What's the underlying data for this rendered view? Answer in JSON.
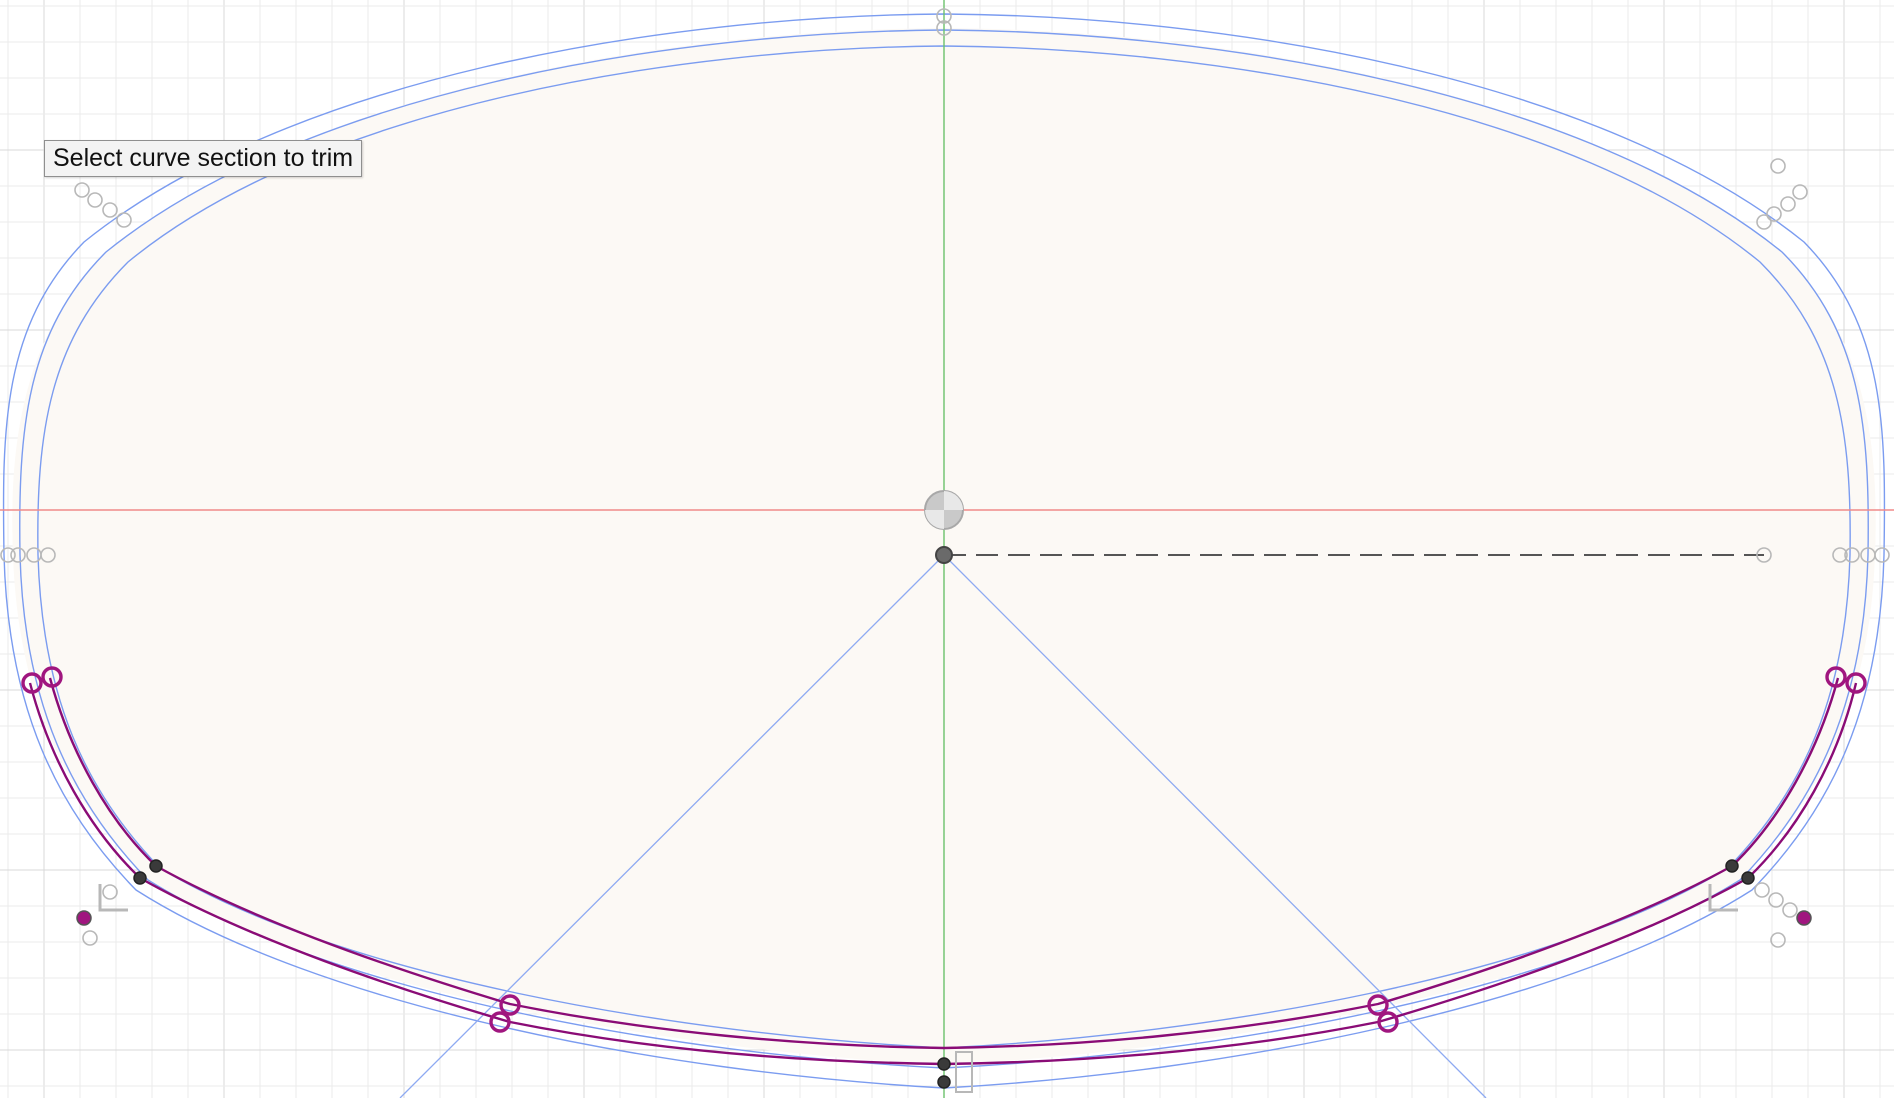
{
  "tooltip": {
    "text": "Select curve section to trim"
  },
  "colors": {
    "background": "#ffffff",
    "grid_minor": "#ebebeb",
    "grid_major": "#d9d9d9",
    "profile_fill": "#fcf9f5",
    "offset_curve": "#7b9cf0",
    "construction_line": "#8eaaf2",
    "x_axis": "#f08a8a",
    "y_axis": "#6cc26c",
    "selected_curve": "#8a0c76",
    "constraint_point": "#a0167f",
    "sketch_point": "#3a3a3a",
    "dimension_dash": "#555555",
    "inactive_point": "#b8b8b8"
  },
  "icons": {
    "origin": "origin-icon",
    "sketch_point": "sketch-point-icon",
    "coincident": "coincident-constraint-icon",
    "tangent": "tangent-constraint-icon",
    "perpendicular": "perpendicular-constraint-icon",
    "symmetry": "symmetry-constraint-icon"
  }
}
